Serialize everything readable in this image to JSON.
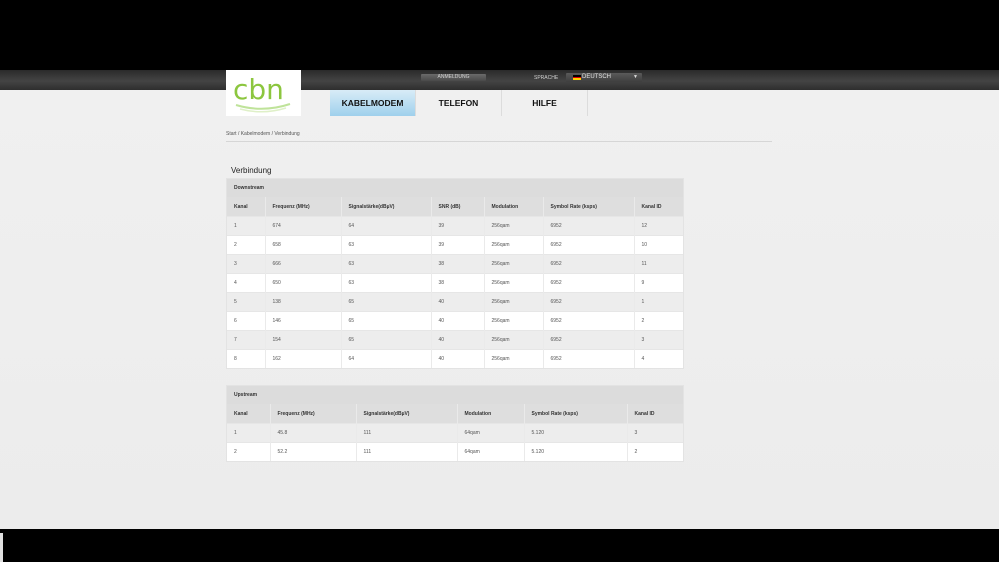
{
  "header": {
    "login_label": "ANMELDUNG",
    "language_label": "SPRACHE",
    "language_value": "DEUTSCH",
    "logo_text": "cbn"
  },
  "nav": {
    "items": [
      {
        "label": "KABELMODEM",
        "active": true
      },
      {
        "label": "TELEFON",
        "active": false
      },
      {
        "label": "HILFE",
        "active": false
      }
    ]
  },
  "breadcrumb": {
    "parts": [
      "Start",
      "Kabelmodem",
      "Verbindung"
    ],
    "text": "Start / Kabelmodem / Verbindung"
  },
  "page_title": "Verbindung",
  "downstream": {
    "title": "Downstream",
    "columns": [
      "Kanal",
      "Frequenz (MHz)",
      "Signalstärke(dBµV)",
      "SNR (dB)",
      "Modulation",
      "Symbol Rate (ksps)",
      "Kanal ID"
    ],
    "rows": [
      [
        "1",
        "674",
        "64",
        "39",
        "256qam",
        "6952",
        "12"
      ],
      [
        "2",
        "658",
        "63",
        "39",
        "256qam",
        "6952",
        "10"
      ],
      [
        "3",
        "666",
        "63",
        "38",
        "256qam",
        "6952",
        "11"
      ],
      [
        "4",
        "650",
        "63",
        "38",
        "256qam",
        "6952",
        "9"
      ],
      [
        "5",
        "138",
        "65",
        "40",
        "256qam",
        "6952",
        "1"
      ],
      [
        "6",
        "146",
        "65",
        "40",
        "256qam",
        "6952",
        "2"
      ],
      [
        "7",
        "154",
        "65",
        "40",
        "256qam",
        "6952",
        "3"
      ],
      [
        "8",
        "162",
        "64",
        "40",
        "256qam",
        "6952",
        "4"
      ]
    ]
  },
  "upstream": {
    "title": "Upstream",
    "columns": [
      "Kanal",
      "Frequenz (MHz)",
      "Signalstärke(dBµV)",
      "Modulation",
      "Symbol Rate (ksps)",
      "Kanal ID"
    ],
    "rows": [
      [
        "1",
        "45.8",
        "111",
        "64qam",
        "5.120",
        "3"
      ],
      [
        "2",
        "52.2",
        "111",
        "64qam",
        "5.120",
        "2"
      ]
    ]
  },
  "colors": {
    "active_tab": "#9fd0ec",
    "logo_green": "#8cc63f",
    "header_bar": "#3a3a3a"
  }
}
